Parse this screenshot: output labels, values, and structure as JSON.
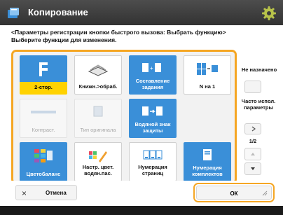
{
  "header": {
    "title": "Копирование",
    "icon": "copy-app-icon",
    "settings_icon": "gear-icon",
    "bg": "#3c3c3c"
  },
  "instructions": {
    "line1": "<Параметры регистрации кнопки быстрого вызова: Выбрать функцию>",
    "line2": "Выберите функции для изменения."
  },
  "functions": [
    {
      "label": "2-стор.",
      "icon": "two-sided-icon",
      "state": "selected"
    },
    {
      "label": "Книжн.>обраб.",
      "icon": "book-copy-icon",
      "state": "normal"
    },
    {
      "label": "Составление задания",
      "icon": "job-build-icon",
      "state": "blue"
    },
    {
      "label": "N на 1",
      "icon": "n-on-1-icon",
      "state": "normal"
    },
    {
      "label": "Контраст.",
      "icon": "sharpness-icon",
      "state": "disabled"
    },
    {
      "label": "Тип оригинала",
      "icon": "original-type-icon",
      "state": "disabled"
    },
    {
      "label": "Водяной знак защиты",
      "icon": "secure-watermark-icon",
      "state": "normal"
    },
    {
      "label": "",
      "icon": "",
      "state": "empty"
    },
    {
      "label": "Цветобаланс",
      "icon": "color-balance-icon",
      "state": "normal"
    },
    {
      "label": "Настр. цвет. водян.пас.",
      "icon": "color-adjust-icon",
      "state": "normal"
    },
    {
      "label": "Нумерация страниц",
      "icon": "page-numbering-icon",
      "state": "normal"
    },
    {
      "label": "Нумерация комплектов",
      "icon": "set-numbering-icon",
      "state": "normal"
    }
  ],
  "side": {
    "no_setting_label": "Не назначено",
    "frequent_label": "Часто испол. параметры",
    "page_indicator": "1/2"
  },
  "footer": {
    "cancel_label": "Отмена",
    "ok_label": "ОК"
  },
  "colors": {
    "accent": "#f5a623",
    "tile_blue": "#3a8fd8",
    "selected": "#ffd200"
  }
}
